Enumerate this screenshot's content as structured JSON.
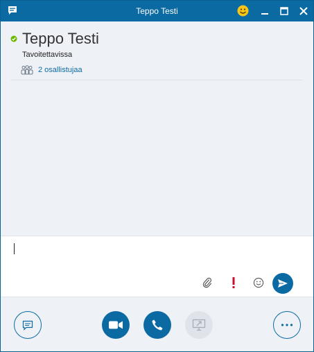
{
  "window": {
    "title": "Teppo Testi"
  },
  "contact": {
    "name": "Teppo Testi",
    "status": "Tavoitettavissa",
    "participants_label": "2 osallistujaa"
  },
  "colors": {
    "accent": "#0b6aa2",
    "presence_available": "#6bb700",
    "priority": "#c8102e"
  },
  "icons": {
    "app": "chat-bubble-icon",
    "smiley": "smiley-icon",
    "attach": "paperclip-icon",
    "priority": "exclamation-icon",
    "emoji": "emoji-icon",
    "send": "send-icon",
    "im": "im-icon",
    "video": "video-camera-icon",
    "call": "phone-icon",
    "share": "screen-share-icon",
    "more": "ellipsis-icon"
  }
}
